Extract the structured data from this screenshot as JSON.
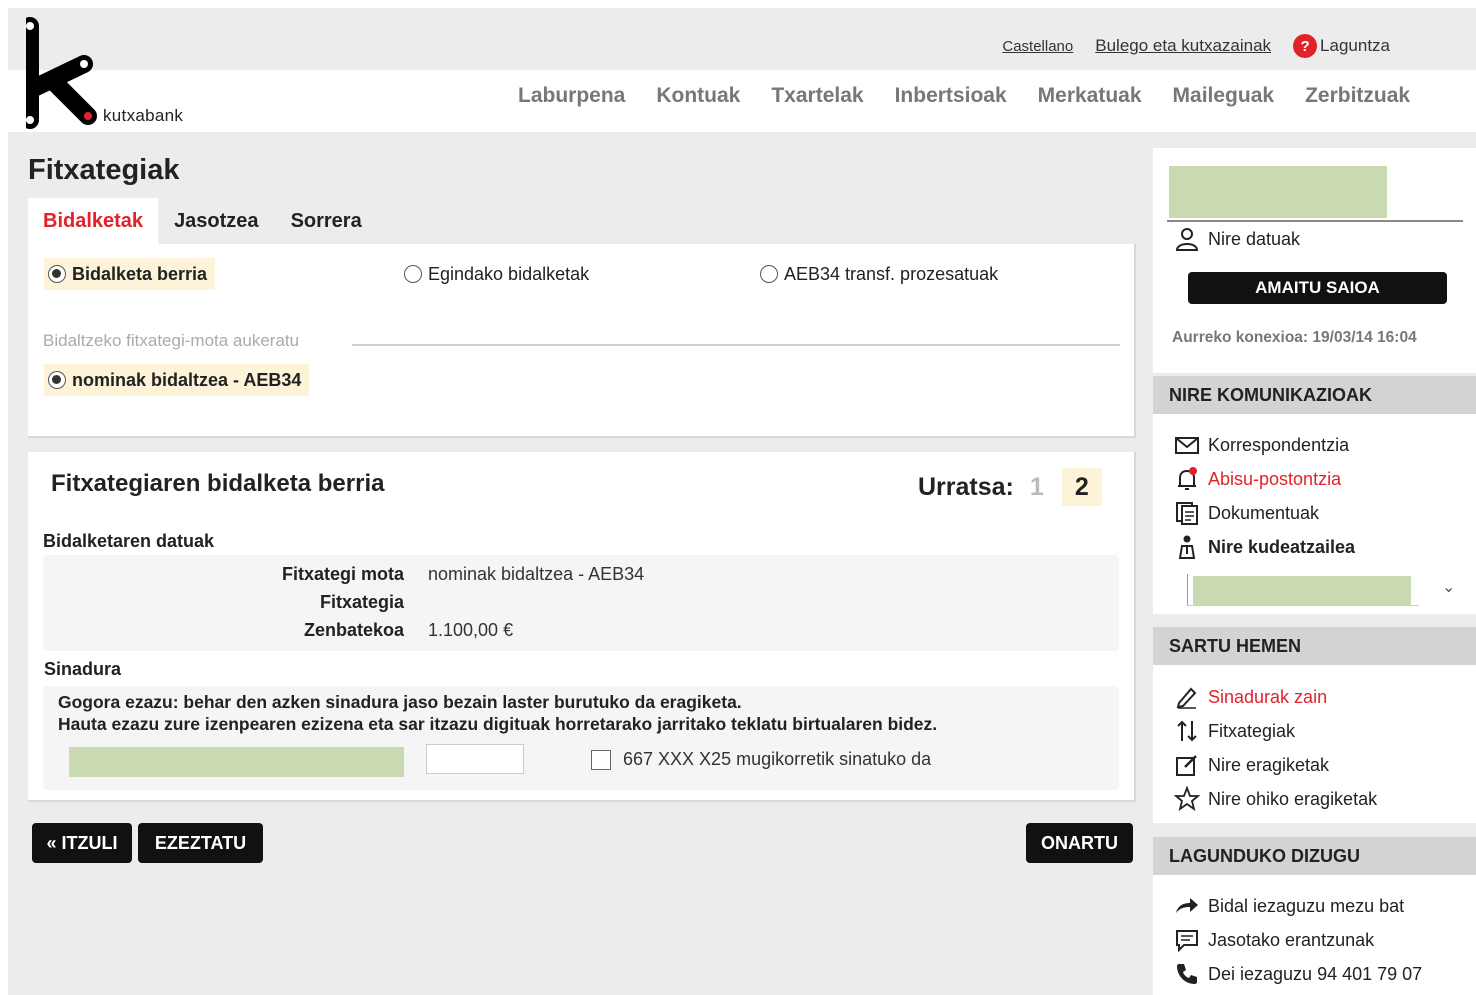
{
  "brand": {
    "name": "kutxabank",
    "accent": "#e0232b"
  },
  "top_links": {
    "language": "Castellano",
    "offices": "Bulego eta kutxazainak",
    "help": "Laguntza",
    "help_icon": "?"
  },
  "nav": [
    "Laburpena",
    "Kontuak",
    "Txartelak",
    "Inbertsioak",
    "Merkatuak",
    "Maileguak",
    "Zerbitzuak"
  ],
  "page": {
    "title": "Fitxategiak",
    "tabs": [
      {
        "label": "Bidalketak",
        "active": true
      },
      {
        "label": "Jasotzea",
        "active": false
      },
      {
        "label": "Sorrera",
        "active": false
      }
    ]
  },
  "send_options": {
    "new": "Bidalketa berria",
    "done": "Egindako bidalketak",
    "aeb34": "AEB34 transf. prozesatuak",
    "selected": "new"
  },
  "file_type": {
    "legend": "Bidaltzeko fitxategi-mota aukeratu",
    "option": "nominak bidaltzea - AEB34"
  },
  "new_send": {
    "title": "Fitxategiaren bidalketa berria",
    "step_label": "Urratsa:",
    "step_1": "1",
    "step_2": "2",
    "details_label": "Bidalketaren datuak",
    "rows": [
      {
        "key": "Fitxategi mota",
        "value": "nominak bidaltzea - AEB34"
      },
      {
        "key": "Fitxategia",
        "value": ""
      },
      {
        "key": "Zenbatekoa",
        "value": "1.100,00 €"
      }
    ],
    "signature_label": "Sinadura",
    "note_1": "Gogora ezazu: behar den azken sinadura jaso bezain laster burutuko da eragiketa.",
    "note_2": "Hauta ezazu zure izenpearen ezizena eta sar itzazu digituak horretarako jarritako teklatu birtualaren bidez.",
    "sign_code_value": "",
    "mobile_check": "667 XXX X25 mugikorretik sinatuko da"
  },
  "buttons": {
    "back": "« ITZULI",
    "cancel": "EZEZTATU",
    "accept": "ONARTU"
  },
  "sidebar": {
    "my_data": "Nire datuak",
    "logout": "AMAITU SAIOA",
    "last_connection": "Aurreko konexioa: 19/03/14 16:04",
    "comms_title": "NIRE KOMUNIKAZIOAK",
    "comms": [
      {
        "label": "Korrespondentzia",
        "icon": "envelope-icon"
      },
      {
        "label": "Abisu-postontzia",
        "icon": "bell-alert-icon"
      },
      {
        "label": "Dokumentuak",
        "icon": "documents-icon"
      },
      {
        "label": "Nire kudeatzailea",
        "icon": "manager-icon"
      }
    ],
    "enter_title": "SARTU HEMEN",
    "enter": [
      {
        "label": "Sinadurak zain",
        "icon": "pen-icon"
      },
      {
        "label": "Fitxategiak",
        "icon": "transfer-arrows-icon"
      },
      {
        "label": "Nire eragiketak",
        "icon": "edit-icon"
      },
      {
        "label": "Nire ohiko eragiketak",
        "icon": "star-icon"
      }
    ],
    "help_title": "LAGUNDUKO DIZUGU",
    "help": [
      {
        "label": "Bidal iezaguzu mezu bat",
        "icon": "arrow-right-icon"
      },
      {
        "label": "Jasotako erantzunak",
        "icon": "chat-icon"
      },
      {
        "label": "Dei iezaguzu 94 401 79 07",
        "icon": "phone-icon"
      }
    ]
  }
}
